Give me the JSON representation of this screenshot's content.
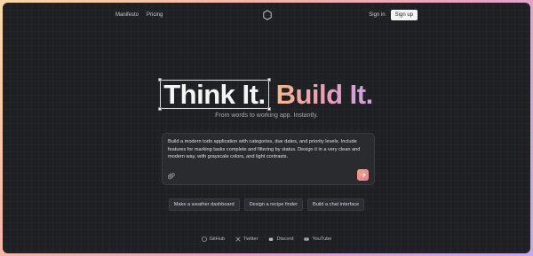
{
  "nav": {
    "left_links": [
      "Manifesto",
      "Pricing"
    ],
    "signin": "Sign in",
    "signup": "Sign up"
  },
  "hero": {
    "word1": "Think It.",
    "word2": "Build It.",
    "subtitle": "From words to working app. Instantly."
  },
  "prompt": {
    "text": "Build a modern todo application with categories, due dates, and priority levels. Include features for marking tasks complete and filtering by status. Design it in a very clean and modern way, with grayscale colors, and light contrasts.",
    "attach_icon": "paperclip-icon",
    "send_icon": "arrow-right-icon"
  },
  "suggestions": [
    "Make a weather dashboard",
    "Design a recipe finder",
    "Build a chat interface"
  ],
  "footer": {
    "links": [
      {
        "label": "GitHub",
        "icon": "github-icon"
      },
      {
        "label": "Twitter",
        "icon": "twitter-icon"
      },
      {
        "label": "Discord",
        "icon": "discord-icon"
      },
      {
        "label": "YouTube",
        "icon": "youtube-icon"
      }
    ]
  },
  "colors": {
    "background": "#1f2023",
    "accent_gradient_start": "#f2a579",
    "accent_gradient_end": "#e77a9b"
  }
}
